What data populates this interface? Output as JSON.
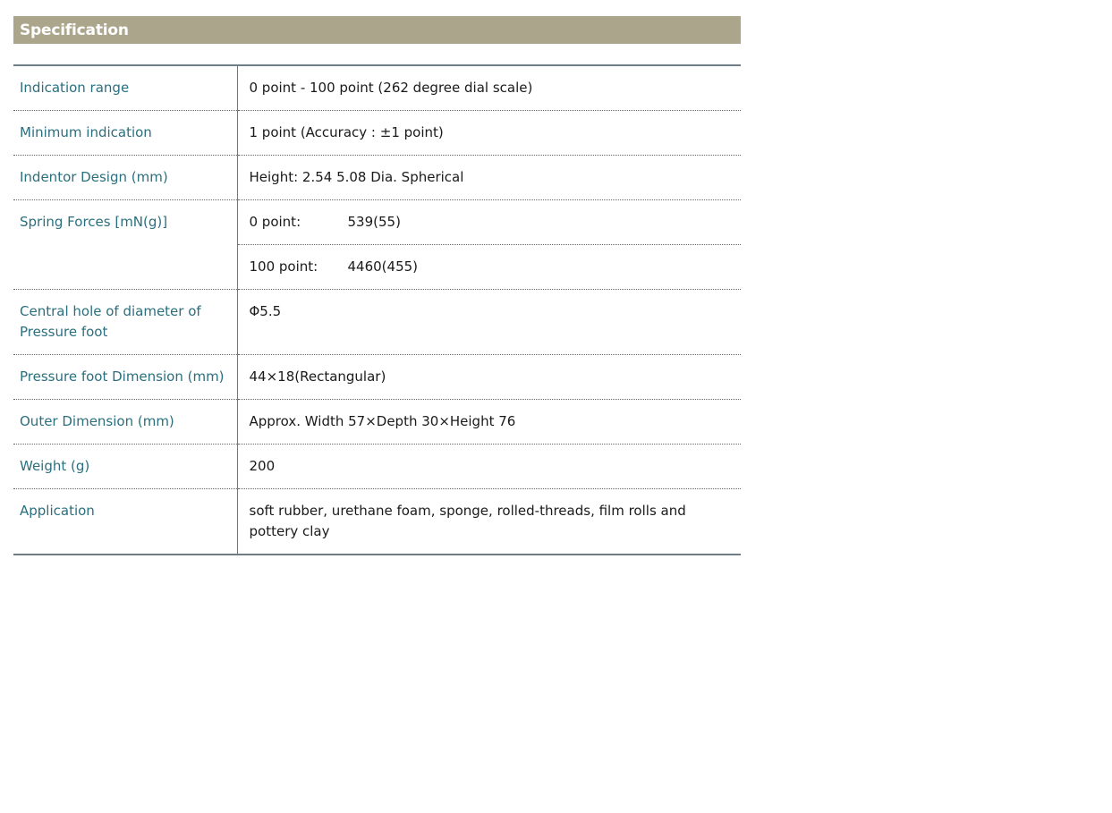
{
  "header": {
    "title": "Specification"
  },
  "spec": {
    "indication_range": {
      "label": "Indication range",
      "value": "0 point - 100 point (262 degree dial scale)"
    },
    "minimum_indication": {
      "label": "Minimum indication",
      "value": "1 point (Accuracy : ±1 point)"
    },
    "indentor_design": {
      "label": "Indentor Design (mm)",
      "value": "Height: 2.54 5.08 Dia. Spherical"
    },
    "spring_forces": {
      "label": "Spring Forces [mN(g)]",
      "row1_label": "0 point:",
      "row1_value": "539(55)",
      "row2_label": "100 point:",
      "row2_value": "4460(455)"
    },
    "central_hole": {
      "label": "Central hole of diameter of Pressure foot",
      "value": "Φ5.5"
    },
    "pressure_foot": {
      "label": "Pressure foot Dimension (mm)",
      "value": "44×18(Rectangular)"
    },
    "outer_dimension": {
      "label": "Outer Dimension (mm)",
      "value": "Approx. Width 57×Depth 30×Height 76"
    },
    "weight": {
      "label": "Weight (g)",
      "value": "200"
    },
    "application": {
      "label": "Application",
      "value": "soft rubber, urethane foam, sponge, rolled-threads, film rolls and pottery clay"
    }
  },
  "colors": {
    "header_bg": "#aba58b",
    "label_text": "#2a6f7e",
    "table_rule": "#6e7d86"
  }
}
